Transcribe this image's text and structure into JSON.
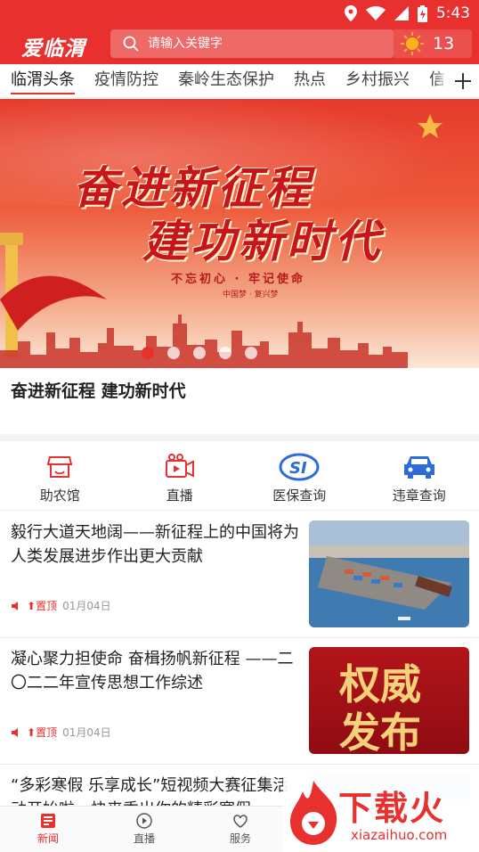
{
  "status_bar": {
    "time": "5:43"
  },
  "header": {
    "logo": "爱临渭",
    "search_placeholder": "请输入关键字",
    "temperature": "13"
  },
  "tabs": [
    "临渭头条",
    "疫情防控",
    "秦岭生态保护",
    "热点",
    "乡村振兴",
    "信"
  ],
  "banner": {
    "line1": "奋进新征程",
    "line2": "建功新时代",
    "slogan": "不忘初心 · 牢记使命",
    "subslogan": "中国梦 · 复兴梦",
    "caption": "奋进新征程  建功新时代",
    "slide_count": 5,
    "active_slide": 0
  },
  "services": [
    {
      "label": "助农馆",
      "icon": "shop-icon"
    },
    {
      "label": "直播",
      "icon": "live-camera-icon"
    },
    {
      "label": "医保查询",
      "icon": "si-icon"
    },
    {
      "label": "违章查询",
      "icon": "car-icon"
    }
  ],
  "news": [
    {
      "title": "毅行大道天地阔——新征程上的中国将为人类发展进步作出更大贡献",
      "pin": "置顶",
      "date": "01月04日",
      "thumb": "port-photo"
    },
    {
      "title": "凝心聚力担使命 奋楫扬帆新征程 ——二〇二二年宣传思想工作综述",
      "pin": "置顶",
      "date": "01月04日",
      "thumb": "authority-release",
      "thumb_text_1": "权威",
      "thumb_text_2": "发布"
    },
    {
      "title": "“多彩寒假 乐享成长”短视频大赛征集活动开始啦，快来秀出你的精彩寒假",
      "thumb": "sky-photo"
    }
  ],
  "bottom_nav": [
    {
      "label": "新闻",
      "active": true
    },
    {
      "label": "直播",
      "active": false
    },
    {
      "label": "服务",
      "active": false
    }
  ],
  "watermark": {
    "big": "下载火",
    "small": "xiazaihuo.com"
  },
  "colors": {
    "brand": "#e8312f"
  }
}
